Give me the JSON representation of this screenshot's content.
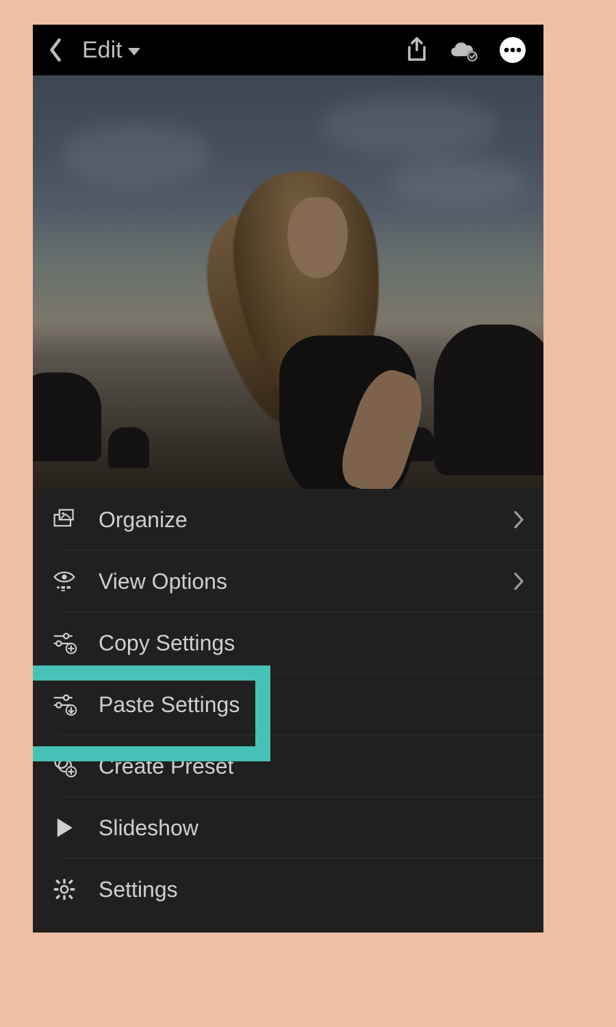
{
  "header": {
    "mode_label": "Edit"
  },
  "menu": {
    "items": [
      {
        "key": "organize",
        "label": "Organize",
        "has_chevron": true
      },
      {
        "key": "view-options",
        "label": "View Options",
        "has_chevron": true
      },
      {
        "key": "copy-settings",
        "label": "Copy Settings",
        "has_chevron": false
      },
      {
        "key": "paste-settings",
        "label": "Paste Settings",
        "has_chevron": false
      },
      {
        "key": "create-preset",
        "label": "Create Preset",
        "has_chevron": false
      },
      {
        "key": "slideshow",
        "label": "Slideshow",
        "has_chevron": false
      },
      {
        "key": "settings",
        "label": "Settings",
        "has_chevron": false
      }
    ]
  },
  "annotation": {
    "highlighted_item_key": "paste-settings",
    "highlight_color": "#47c2b6"
  }
}
